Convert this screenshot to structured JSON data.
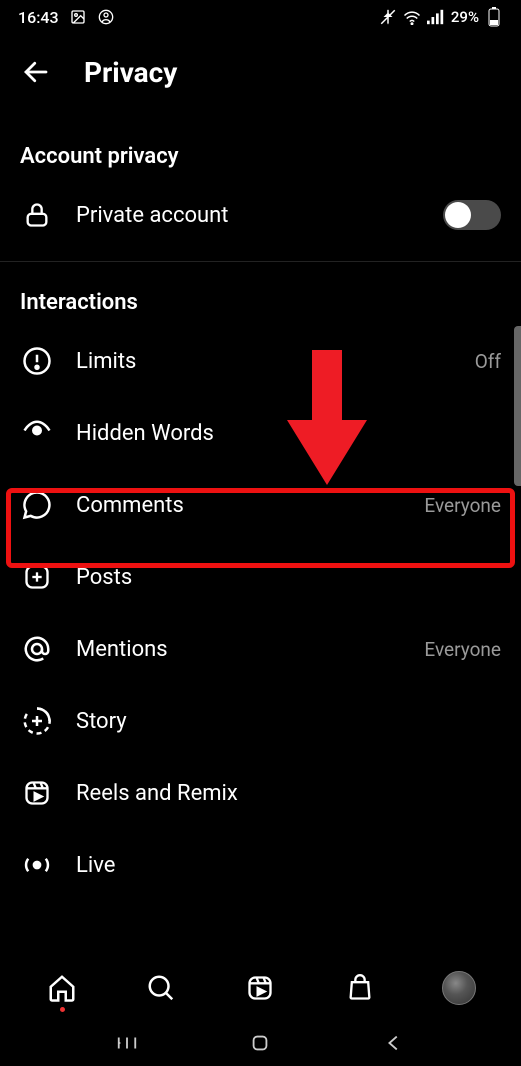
{
  "status": {
    "time": "16:43",
    "battery_pct": "29%"
  },
  "header": {
    "title": "Privacy"
  },
  "sections": {
    "account_privacy": {
      "title": "Account privacy",
      "private_account_label": "Private account"
    },
    "interactions": {
      "title": "Interactions",
      "limits": {
        "label": "Limits",
        "value": "Off"
      },
      "hidden_words": {
        "label": "Hidden Words"
      },
      "comments": {
        "label": "Comments",
        "value": "Everyone"
      },
      "posts": {
        "label": "Posts"
      },
      "mentions": {
        "label": "Mentions",
        "value": "Everyone"
      },
      "story": {
        "label": "Story"
      },
      "reels": {
        "label": "Reels and Remix"
      },
      "live": {
        "label": "Live"
      }
    }
  }
}
